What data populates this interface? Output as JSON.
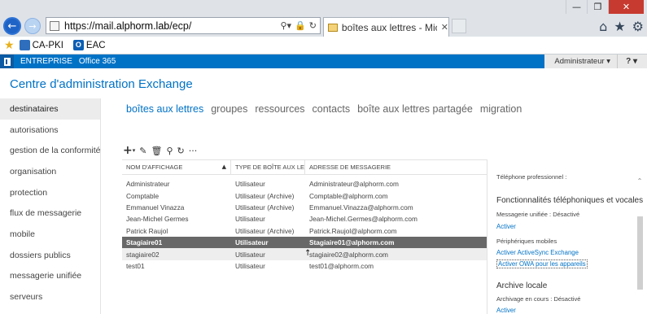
{
  "browser": {
    "url_prefix": "https://mail.",
    "url_domain": "alphorm.lab",
    "url_suffix": "/ecp/",
    "tab_title": "boîtes aux lettres - Microso...",
    "favorites": [
      {
        "label": "CA-PKI"
      },
      {
        "label": "EAC"
      }
    ]
  },
  "topbar": {
    "links": [
      "ENTREPRISE",
      "Office 365"
    ],
    "user": "Administrateur",
    "help": "?"
  },
  "page": {
    "title": "Centre d'administration Exchange"
  },
  "leftnav": {
    "items": [
      "destinataires",
      "autorisations",
      "gestion de la conformité",
      "organisation",
      "protection",
      "flux de messagerie",
      "mobile",
      "dossiers publics",
      "messagerie unifiée",
      "serveurs"
    ],
    "active_index": 0
  },
  "subtabs": [
    "boîtes aux lettres",
    "groupes",
    "ressources",
    "contacts",
    "boîte aux lettres partagée",
    "migration"
  ],
  "table": {
    "headers": [
      "NOM D'AFFICHAGE",
      "TYPE DE BOÎTE AUX LETT...",
      "ADRESSE DE MESSAGERIE"
    ],
    "rows": [
      [
        "Administrateur",
        "Utilisateur",
        "Administrateur@alphorm.com"
      ],
      [
        "Comptable",
        "Utilisateur (Archive)",
        "Comptable@alphorm.com"
      ],
      [
        "Emmanuel Vinazza",
        "Utilisateur (Archive)",
        "Emmanuel.Vinazza@alphorm.com"
      ],
      [
        "Jean-Michel Germes",
        "Utilisateur",
        "Jean-Michel.Germes@alphorm.com"
      ],
      [
        "Patrick Raujol",
        "Utilisateur (Archive)",
        "Patrick.Raujol@alphorm.com"
      ],
      [
        "Stagiaire01",
        "Utilisateur",
        "Stagiaire01@alphorm.com"
      ],
      [
        "stagiaire02",
        "Utilisateur",
        "stagiaire02@alphorm.com"
      ],
      [
        "test01",
        "Utilisateur",
        "test01@alphorm.com"
      ]
    ],
    "selected_index": 5,
    "hover_index": 6
  },
  "details": {
    "work_phone": "Téléphone professionnel :",
    "phone_features_title": "Fonctionnalités téléphoniques et vocales",
    "um_status": "Messagerie unifiée : Désactivé",
    "um_enable": "Activer",
    "mobile_devices": "Périphériques mobiles",
    "activesync_disable": "Activer ActiveSync Exchange",
    "owa_devices": "Activer OWA pour les appareils",
    "archive_title": "Archive locale",
    "archive_status": "Archivage en cours : Désactivé",
    "archive_enable": "Activer"
  }
}
